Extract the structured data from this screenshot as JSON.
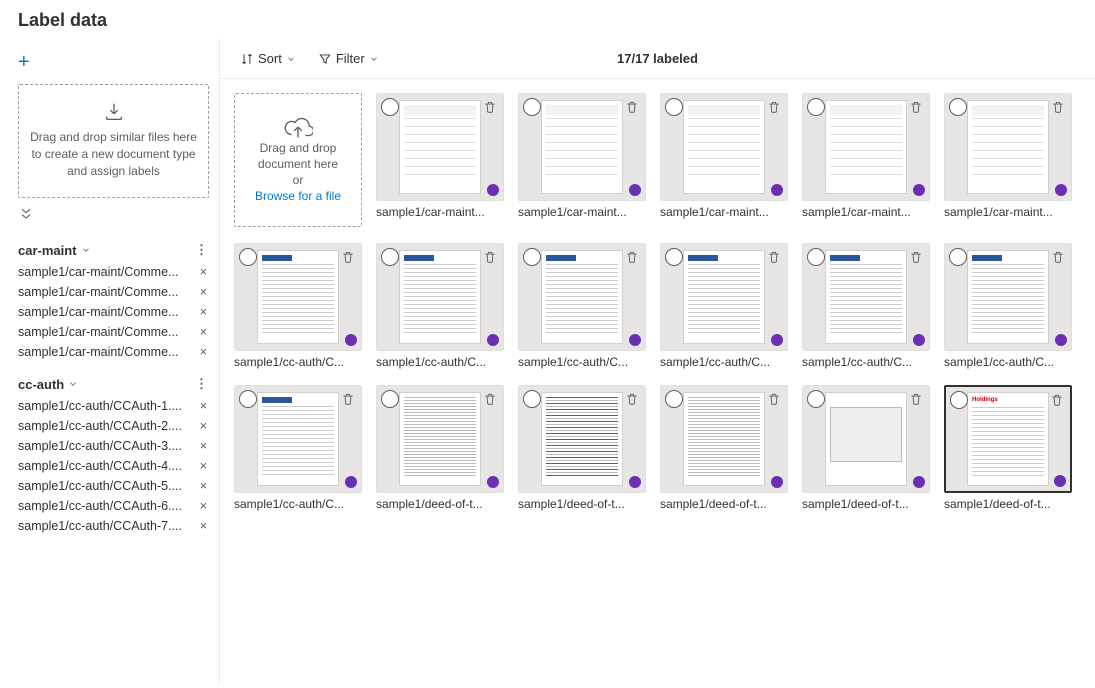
{
  "header": {
    "title": "Label data"
  },
  "sidebar": {
    "add_label": "+",
    "dropzone_text": "Drag and drop similar files here to create a new document type and assign labels",
    "groups": [
      {
        "name": "car-maint",
        "files": [
          "sample1/car-maint/Comme...",
          "sample1/car-maint/Comme...",
          "sample1/car-maint/Comme...",
          "sample1/car-maint/Comme...",
          "sample1/car-maint/Comme..."
        ]
      },
      {
        "name": "cc-auth",
        "files": [
          "sample1/cc-auth/CCAuth-1....",
          "sample1/cc-auth/CCAuth-2....",
          "sample1/cc-auth/CCAuth-3....",
          "sample1/cc-auth/CCAuth-4....",
          "sample1/cc-auth/CCAuth-5....",
          "sample1/cc-auth/CCAuth-6....",
          "sample1/cc-auth/CCAuth-7...."
        ]
      }
    ]
  },
  "toolbar": {
    "sort_label": "Sort",
    "filter_label": "Filter",
    "status": "17/17 labeled"
  },
  "upload": {
    "line1": "Drag and drop document here",
    "line2": "or",
    "link": "Browse for a file"
  },
  "docs": [
    {
      "caption": "sample1/car-maint...",
      "variant": "tbl",
      "selected": false
    },
    {
      "caption": "sample1/car-maint...",
      "variant": "tbl",
      "selected": false
    },
    {
      "caption": "sample1/car-maint...",
      "variant": "tbl",
      "selected": false
    },
    {
      "caption": "sample1/car-maint...",
      "variant": "tbl",
      "selected": false
    },
    {
      "caption": "sample1/car-maint...",
      "variant": "tbl",
      "selected": false
    },
    {
      "caption": "sample1/cc-auth/C...",
      "variant": "letter",
      "selected": false
    },
    {
      "caption": "sample1/cc-auth/C...",
      "variant": "letter",
      "selected": false
    },
    {
      "caption": "sample1/cc-auth/C...",
      "variant": "letter",
      "selected": false
    },
    {
      "caption": "sample1/cc-auth/C...",
      "variant": "letter",
      "selected": false
    },
    {
      "caption": "sample1/cc-auth/C...",
      "variant": "letter",
      "selected": false
    },
    {
      "caption": "sample1/cc-auth/C...",
      "variant": "letter",
      "selected": false
    },
    {
      "caption": "sample1/cc-auth/C...",
      "variant": "letter",
      "selected": false
    },
    {
      "caption": "sample1/deed-of-t...",
      "variant": "form",
      "selected": false
    },
    {
      "caption": "sample1/deed-of-t...",
      "variant": "formred",
      "selected": false
    },
    {
      "caption": "sample1/deed-of-t...",
      "variant": "form",
      "selected": false
    },
    {
      "caption": "sample1/deed-of-t...",
      "variant": "box",
      "selected": false
    },
    {
      "caption": "sample1/deed-of-t...",
      "variant": "logo",
      "selected": true
    }
  ],
  "colors": {
    "accent": "#0078d4",
    "label_dot": "#6b2fb3"
  }
}
